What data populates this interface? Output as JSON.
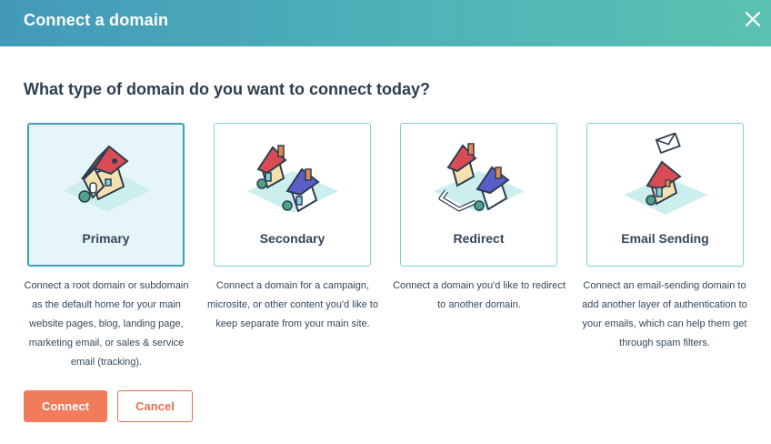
{
  "header": {
    "title": "Connect a domain"
  },
  "question": "What type of domain do you want to connect today?",
  "options": [
    {
      "label": "Primary",
      "description": "Connect a root domain or subdomain as the default home for your main website pages, blog, landing page, marketing email, or sales & service email (tracking).",
      "selected": true,
      "icon": "house-icon"
    },
    {
      "label": "Secondary",
      "description": "Connect a domain for a campaign, microsite, or other content you'd like to keep separate from your main site.",
      "selected": false,
      "icon": "two-houses-icon"
    },
    {
      "label": "Redirect",
      "description": "Connect a domain you'd like to redirect to another domain.",
      "selected": false,
      "icon": "redirect-houses-icon"
    },
    {
      "label": "Email Sending",
      "description": "Connect an email-sending domain to add another layer of authentication to your emails, which can help them get through spam filters.",
      "selected": false,
      "icon": "house-envelope-icon"
    }
  ],
  "actions": {
    "connect": "Connect",
    "cancel": "Cancel"
  },
  "colors": {
    "accent": "#f07c5c",
    "header_start": "#4299b9",
    "header_end": "#5bc1b0",
    "card_border": "#7fd1de",
    "selected_bg": "#e5f5f8"
  }
}
